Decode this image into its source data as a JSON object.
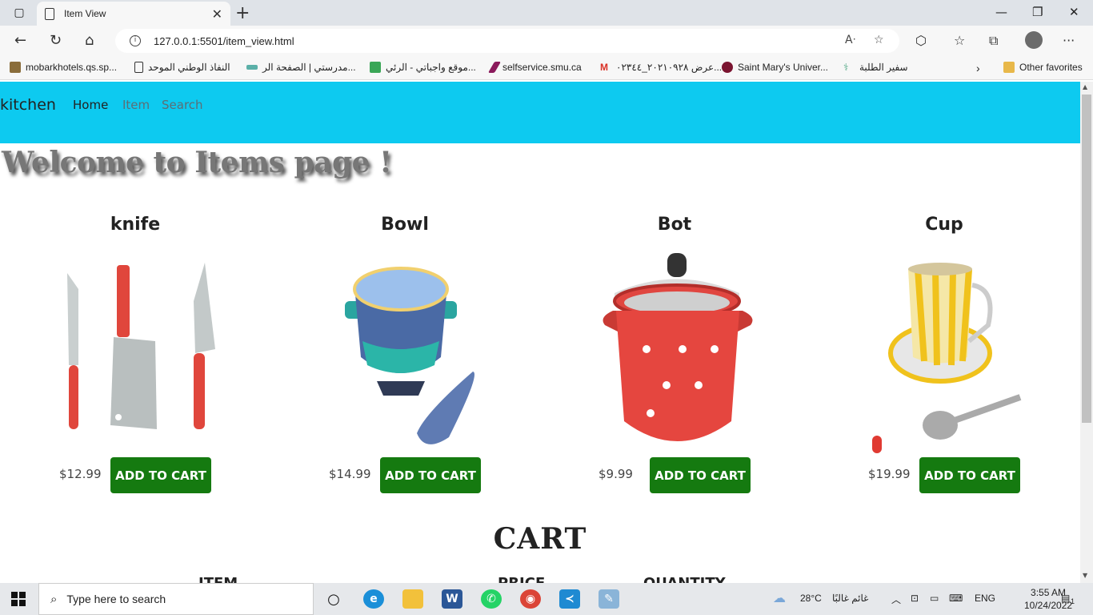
{
  "browser": {
    "tab_title": "Item View",
    "url": "127.0.0.1:5501/item_view.html",
    "favorites": [
      "mobarkhotels.qs.sp...",
      "النفاذ الوطني الموحد",
      "مدرستي | الصفحة الر...",
      "موقع واجباتي - الرئي...",
      "selfservice.smu.ca",
      "عرض ٢٠٢١٠٩٢٨_٠٢٣٤٤...",
      "Saint Mary's Univer...",
      "سفير الطلبة"
    ],
    "other_favorites": "Other favorites"
  },
  "site": {
    "brand": "kitchen",
    "nav": [
      "Home",
      "Item",
      "Search"
    ],
    "welcome": "Welcome to Items page !",
    "add_to_cart_label": "ADD TO CART",
    "products": [
      {
        "name": "knife",
        "price": "$12.99",
        "icon": "knives-image"
      },
      {
        "name": "Bowl",
        "price": "$14.99",
        "icon": "bowl-image"
      },
      {
        "name": "Bot",
        "price": "$9.99",
        "icon": "pot-image"
      },
      {
        "name": "Cup",
        "price": "$19.99",
        "icon": "cup-image"
      }
    ],
    "cart_title": "CART",
    "cart_headers": [
      "ITEM",
      "PRICE",
      "QUANTITY"
    ]
  },
  "taskbar": {
    "search_placeholder": "Type here to search",
    "weather": "28°C",
    "weather_text": "غائم غالبًا",
    "language": "ENG",
    "time": "3:55 AM",
    "date": "10/24/2022",
    "notification_count": "1"
  }
}
